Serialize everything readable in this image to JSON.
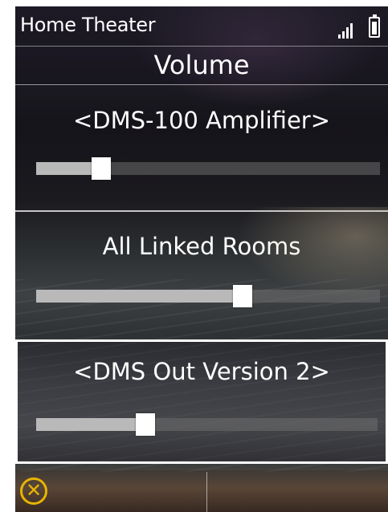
{
  "status_bar": {
    "app_title": "Home Theater",
    "signal_icon": "signal-bars-icon",
    "battery_icon": "battery-icon"
  },
  "page_title": "Volume",
  "zones": [
    {
      "label": "<DMS-100 Amplifier>",
      "volume_fraction": 0.19,
      "selected": false
    },
    {
      "label": "All Linked Rooms",
      "volume_fraction": 0.6,
      "selected": false
    },
    {
      "label": "<DMS Out Version 2>",
      "volume_fraction": 0.32,
      "selected": true
    }
  ],
  "bottom_bar": {
    "close_icon": "close-circle-icon",
    "close_glyph": "✕"
  },
  "colors": {
    "accent": "#e8b400",
    "text": "#ffffff",
    "slider_fill": "#b9b9b9"
  }
}
